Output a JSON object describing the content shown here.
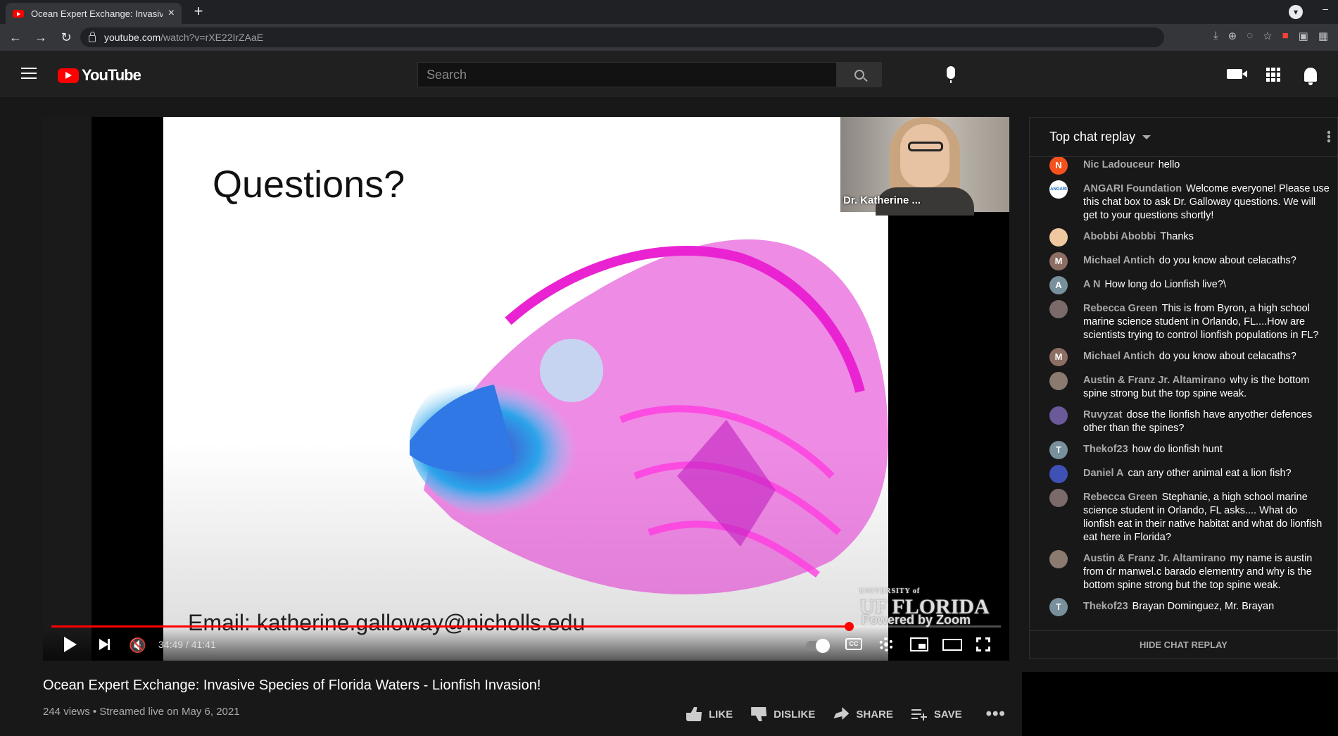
{
  "browser": {
    "tab_title": "Ocean Expert Exchange: Invasive",
    "new_tab": "+",
    "url_host": "youtube.com",
    "url_path": "/watch?v=rXE22IrZAaE"
  },
  "header": {
    "logo_text": "YouTube",
    "search_placeholder": "Search"
  },
  "player": {
    "slide_title": "Questions?",
    "slide_email": "Email:  katherine.galloway@nicholls.edu",
    "uf_small": "UNIVERSITY of",
    "uf_logo": "UF FLORIDA",
    "zoom_text": "Powered by Zoom",
    "cam_name": "Dr. Katherine ...",
    "time": "34:49 / 41:41",
    "progress": 0.84,
    "cc_label": "CC"
  },
  "video": {
    "title": "Ocean Expert Exchange: Invasive Species of Florida Waters - Lionfish Invasion!",
    "meta": "244 views • Streamed live on May 6, 2021",
    "like_label": "LIKE",
    "dislike_label": "DISLIKE",
    "share_label": "SHARE",
    "save_label": "SAVE",
    "more": "•••"
  },
  "chat": {
    "header": "Top chat replay",
    "footer": "HIDE CHAT REPLAY",
    "messages": [
      {
        "initial": "N",
        "color": "#f4511e",
        "author": "Nic Ladouceur",
        "text": "hello"
      },
      {
        "initial": "ANGARI",
        "color": "#ffffff",
        "author": "ANGARI Foundation",
        "text": "Welcome everyone! Please use this chat box to ask Dr. Galloway questions. We will get to your questions shortly!"
      },
      {
        "initial": "",
        "color": "#f0c8a0",
        "author": "Abobbi Abobbi",
        "text": "Thanks"
      },
      {
        "initial": "M",
        "color": "#8d6e63",
        "author": "Michael Antich",
        "text": "do you know about celacaths?"
      },
      {
        "initial": "A",
        "color": "#78909c",
        "author": "A N",
        "text": "How long do Lionfish live?\\"
      },
      {
        "initial": "",
        "color": "#7a6a6a",
        "author": "Rebecca Green",
        "text": "This is from Byron, a high school marine science student in Orlando, FL....How are scientists trying to control lionfish populations in FL?"
      },
      {
        "initial": "M",
        "color": "#8d6e63",
        "author": "Michael Antich",
        "text": "do you know about celacaths?"
      },
      {
        "initial": "",
        "color": "#8a7a70",
        "author": "Austin & Franz Jr. Altamirano",
        "text": "why is the bottom spine strong but the top spine weak."
      },
      {
        "initial": "",
        "color": "#6a5a9a",
        "author": "Ruvyzat",
        "text": "dose the lionfish have anyother defences other than the spines?"
      },
      {
        "initial": "T",
        "color": "#78909c",
        "author": "Thekof23",
        "text": "how do lionfish hunt"
      },
      {
        "initial": "",
        "color": "#3f51b5",
        "author": "Daniel A",
        "text": "can any other animal eat a lion fish?"
      },
      {
        "initial": "",
        "color": "#7a6a6a",
        "author": "Rebecca Green",
        "text": "Stephanie, a high school marine science student in Orlando, FL asks.... What do lionfish eat in their native habitat and what do lionfish eat here in Florida?"
      },
      {
        "initial": "",
        "color": "#8a7a70",
        "author": "Austin & Franz Jr. Altamirano",
        "text": "my name is austin from dr manwel.c barado elementry and why is the bottom spine strong but the top spine weak."
      },
      {
        "initial": "T",
        "color": "#78909c",
        "author": "Thekof23",
        "text": "Brayan Dominguez, Mr. Brayan"
      }
    ]
  }
}
